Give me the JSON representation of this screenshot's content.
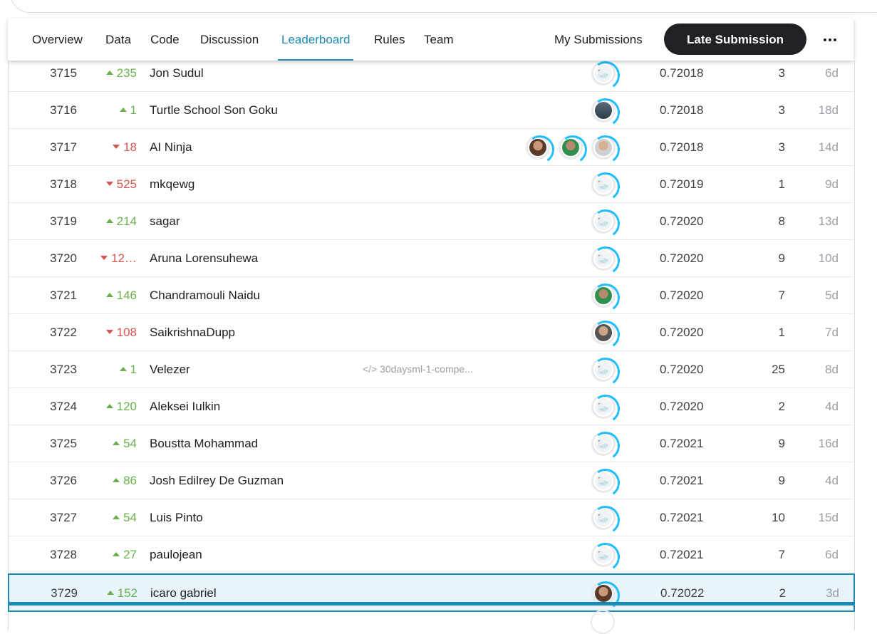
{
  "tabs": [
    {
      "label": "Overview",
      "active": false
    },
    {
      "label": "Data",
      "active": false
    },
    {
      "label": "Code",
      "active": false
    },
    {
      "label": "Discussion",
      "active": false
    },
    {
      "label": "Leaderboard",
      "active": true
    },
    {
      "label": "Rules",
      "active": false
    },
    {
      "label": "Team",
      "active": false
    }
  ],
  "my_submissions_label": "My Submissions",
  "late_submission_label": "Late Submission",
  "accent_color": "#1a8ab5",
  "up_color": "#6ab04c",
  "down_color": "#d9534f",
  "rows": [
    {
      "rank": "3715",
      "dir": "up",
      "delta": "235",
      "team": "Jon Sudul",
      "notebook": "",
      "avatars": [
        "default"
      ],
      "score": "0.72018",
      "entries": "3",
      "last": "6d"
    },
    {
      "rank": "3716",
      "dir": "up",
      "delta": "1",
      "team": "Turtle School Son Goku",
      "notebook": "",
      "avatars": [
        "photo-building"
      ],
      "score": "0.72018",
      "entries": "3",
      "last": "18d"
    },
    {
      "rank": "3717",
      "dir": "down",
      "delta": "18",
      "team": "AI Ninja",
      "notebook": "",
      "avatars": [
        "photo-brown",
        "photo-green",
        "photo-light"
      ],
      "score": "0.72018",
      "entries": "3",
      "last": "14d"
    },
    {
      "rank": "3718",
      "dir": "down",
      "delta": "525",
      "team": "mkqewg",
      "notebook": "",
      "avatars": [
        "default"
      ],
      "score": "0.72019",
      "entries": "1",
      "last": "9d"
    },
    {
      "rank": "3719",
      "dir": "up",
      "delta": "214",
      "team": "sagar",
      "notebook": "",
      "avatars": [
        "default"
      ],
      "score": "0.72020",
      "entries": "8",
      "last": "13d"
    },
    {
      "rank": "3720",
      "dir": "down",
      "delta": "12…",
      "team": "Aruna Lorensuhewa",
      "notebook": "",
      "avatars": [
        "default"
      ],
      "score": "0.72020",
      "entries": "9",
      "last": "10d"
    },
    {
      "rank": "3721",
      "dir": "up",
      "delta": "146",
      "team": "Chandramouli Naidu",
      "notebook": "",
      "avatars": [
        "photo-green"
      ],
      "score": "0.72020",
      "entries": "7",
      "last": "5d"
    },
    {
      "rank": "3722",
      "dir": "down",
      "delta": "108",
      "team": "SaikrishnaDupp",
      "notebook": "",
      "avatars": [
        "photo-grey"
      ],
      "score": "0.72020",
      "entries": "1",
      "last": "7d"
    },
    {
      "rank": "3723",
      "dir": "up",
      "delta": "1",
      "team": "Velezer",
      "notebook": "30daysml-1-compe...",
      "avatars": [
        "default"
      ],
      "score": "0.72020",
      "entries": "25",
      "last": "8d"
    },
    {
      "rank": "3724",
      "dir": "up",
      "delta": "120",
      "team": "Aleksei Iulkin",
      "notebook": "",
      "avatars": [
        "default"
      ],
      "score": "0.72020",
      "entries": "2",
      "last": "4d"
    },
    {
      "rank": "3725",
      "dir": "up",
      "delta": "54",
      "team": "Boustta Mohammad",
      "notebook": "",
      "avatars": [
        "default"
      ],
      "score": "0.72021",
      "entries": "9",
      "last": "16d"
    },
    {
      "rank": "3726",
      "dir": "up",
      "delta": "86",
      "team": "Josh Edilrey De Guzman",
      "notebook": "",
      "avatars": [
        "default"
      ],
      "score": "0.72021",
      "entries": "9",
      "last": "4d"
    },
    {
      "rank": "3727",
      "dir": "up",
      "delta": "54",
      "team": "Luis Pinto",
      "notebook": "",
      "avatars": [
        "default"
      ],
      "score": "0.72021",
      "entries": "10",
      "last": "15d"
    },
    {
      "rank": "3728",
      "dir": "up",
      "delta": "27",
      "team": "paulojean",
      "notebook": "",
      "avatars": [
        "default"
      ],
      "score": "0.72021",
      "entries": "7",
      "last": "6d"
    },
    {
      "rank": "3729",
      "dir": "up",
      "delta": "152",
      "team": "icaro gabriel",
      "notebook": "",
      "avatars": [
        "photo-brown"
      ],
      "score": "0.72022",
      "entries": "2",
      "last": "3d",
      "highlight": true
    }
  ],
  "icons": {
    "more": "more-horizontal-icon",
    "notebook": "code-icon",
    "default_avatar": "goose-avatar-icon"
  }
}
